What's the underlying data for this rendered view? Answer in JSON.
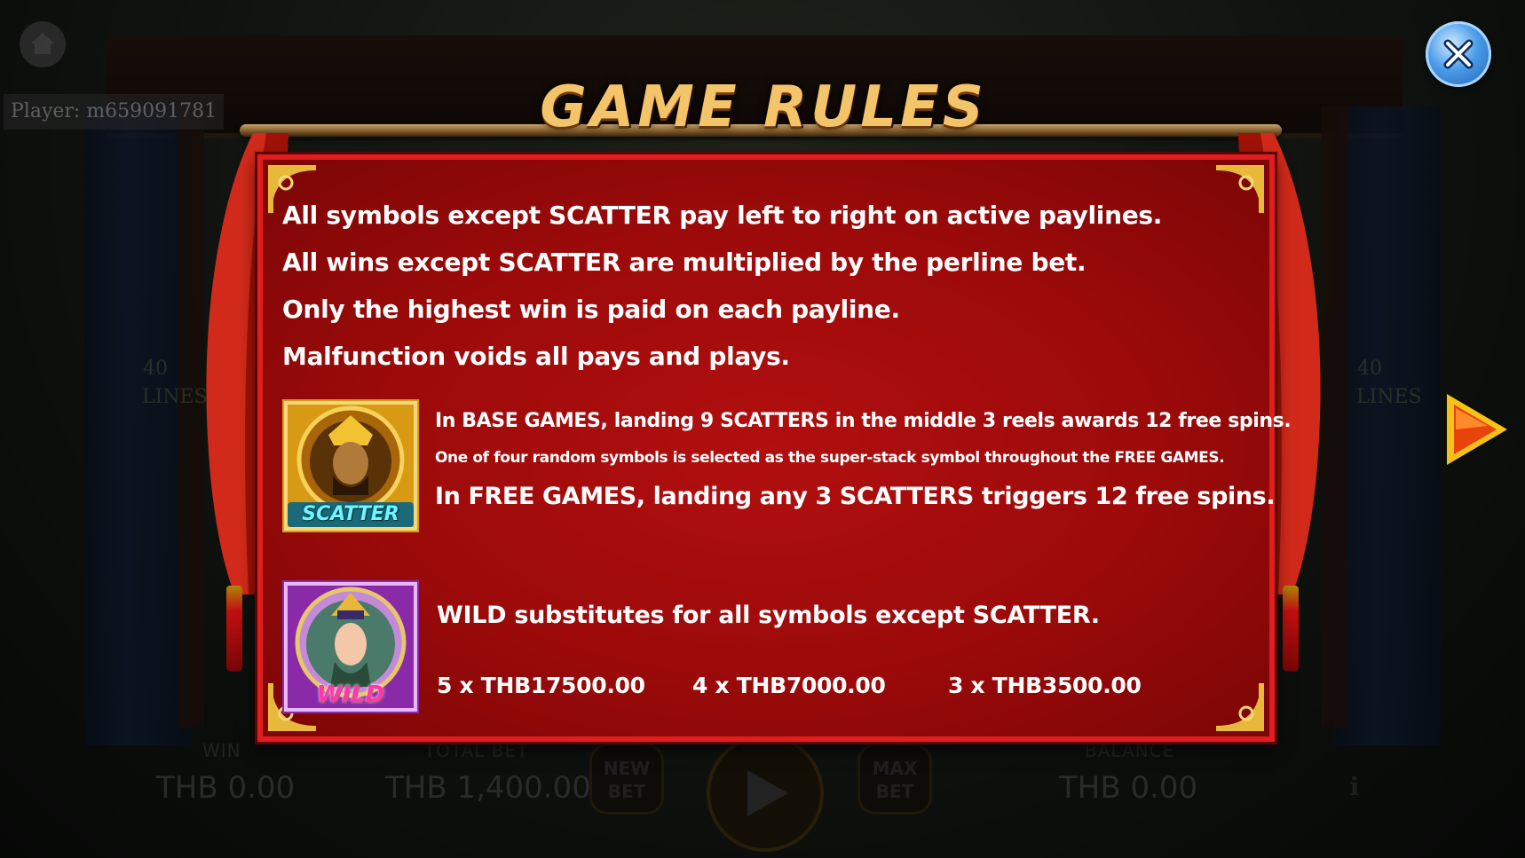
{
  "player": {
    "label": "Player: m659091781"
  },
  "title": "GAME RULES",
  "rules": [
    "All symbols except SCATTER pay left to right on active paylines.",
    "All wins except SCATTER are multiplied by the perline bet.",
    "Only the highest win is paid on each payline.",
    "Malfunction voids all pays and plays."
  ],
  "scatter": {
    "badge": "SCATTER",
    "line1": "In BASE GAMES, landing 9 SCATTERS in the middle 3 reels awards 12 free spins.",
    "line2": "One of four random symbols is selected as the super-stack symbol throughout the FREE GAMES.",
    "line3": "In FREE GAMES, landing any 3 SCATTERS triggers 12 free spins."
  },
  "wild": {
    "badge": "WILD",
    "line1": "WILD substitutes for all symbols except SCATTER.",
    "pays": [
      "5 x THB17500.00",
      "4 x THB7000.00",
      "3 x THB3500.00"
    ]
  },
  "background": {
    "lines_label": "40 LINES",
    "win_label": "WIN",
    "win_value": "THB 0.00",
    "total_bet_label": "TOTAL BET",
    "total_bet_value": "THB 1,400.00",
    "new_bet_label": "NEW BET",
    "max_bet_label": "MAX BET",
    "balance_label": "BALANCE",
    "balance_value": "THB 0.00",
    "info_label": "i"
  },
  "colors": {
    "panel_red": "#9c0a0a",
    "panel_border": "#e11e1e",
    "title_gold": "#f4c46a",
    "close_blue": "#4a9be8",
    "arrow_orange": "#ff6a00"
  },
  "icons": {
    "close": "close-icon",
    "next": "play-arrow-right-icon",
    "home": "home-icon",
    "spin": "play-icon"
  }
}
